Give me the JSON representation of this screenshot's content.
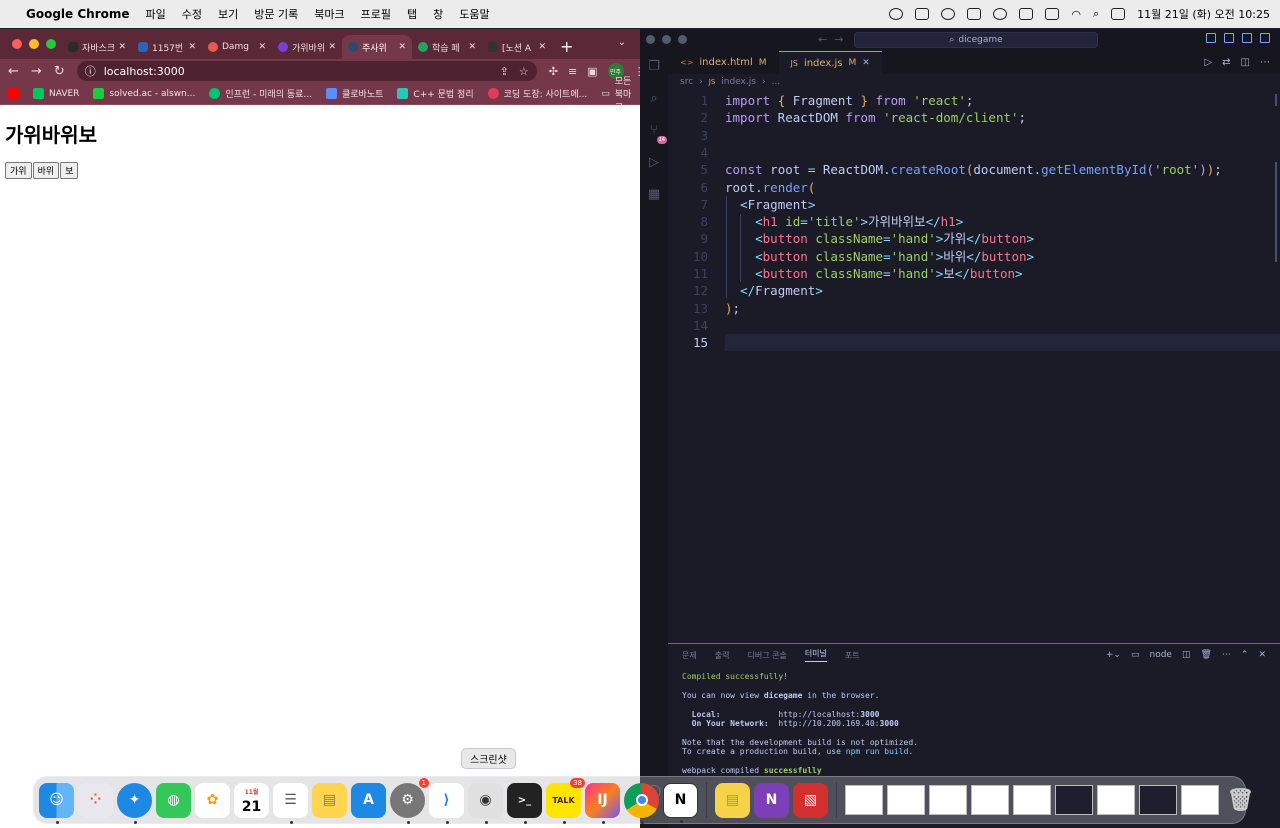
{
  "menubar": {
    "app": "Google Chrome",
    "items": [
      "파일",
      "수정",
      "보기",
      "방문 기록",
      "북마크",
      "프로필",
      "탭",
      "창",
      "도움말"
    ],
    "clock": "11월 21일 (화) 오전 10:25"
  },
  "chrome": {
    "tabs": [
      {
        "label": "자바스크",
        "color": "#2b2b2b"
      },
      {
        "label": "1157번",
        "color": "#2d62b8"
      },
      {
        "label": "Damg",
        "color": "#e85a4f"
      },
      {
        "label": "가위바위",
        "color": "#7b3fd6"
      },
      {
        "label": "주사위",
        "color": "#2a4a6b",
        "active": true
      },
      {
        "label": "학습 페",
        "color": "#1fa463"
      },
      {
        "label": "[노션 A",
        "color": "#333333"
      }
    ],
    "url": "localhost:3000",
    "profile": "민주",
    "bookmarks": [
      {
        "label": "",
        "color": "#ff0000"
      },
      {
        "label": "NAVER",
        "color": "#03c75a"
      },
      {
        "label": "solved.ac - alswn...",
        "color": "#17ce3a"
      },
      {
        "label": "인프런 - 미래의 동료...",
        "color": "#00c471"
      },
      {
        "label": "클로바노트",
        "color": "#5b8dfe"
      },
      {
        "label": "C++ 문법 정리",
        "color": "#2ec4b6"
      },
      {
        "label": "코딩 도장: 사이트에...",
        "color": "#e03c5a"
      }
    ],
    "all_bookmarks": "모든 북마크",
    "page": {
      "title": "가위바위보",
      "buttons": [
        "가위",
        "바위",
        "보"
      ]
    }
  },
  "vscode": {
    "search": "dicegame",
    "tabs": [
      {
        "icon": "<>",
        "label": "index.html",
        "mod": "M"
      },
      {
        "icon": "JS",
        "label": "index.js",
        "mod": "M",
        "active": true
      }
    ],
    "breadcrumb": [
      "src",
      "index.js",
      "..."
    ],
    "line_numbers": [
      "1",
      "2",
      "3",
      "4",
      "5",
      "6",
      "7",
      "8",
      "9",
      "10",
      "11",
      "12",
      "13",
      "14",
      "15"
    ],
    "panel_tabs": [
      "문제",
      "출력",
      "디버그 콘솔",
      "터미널",
      "포트"
    ],
    "panel_shell": "node",
    "terminal": {
      "compiled": "Compiled successfully!",
      "view_pre": "You can now view ",
      "view_app": "dicegame",
      "view_post": " in the browser.",
      "local_label": "Local:",
      "local_url": "http://localhost:",
      "local_port": "3000",
      "network_label": "On Your Network:",
      "network_url": "http://10.200.169.40:",
      "network_port": "3000",
      "note1": "Note that the development build is not optimized.",
      "note2_pre": "To create a production build, use ",
      "note2_cmd": "npm run build",
      "note2_post": ".",
      "webpack_pre": "webpack compiled ",
      "webpack_ok": "successfully"
    }
  },
  "dock": {
    "tooltip": "스크린샷",
    "calendar_month": "11월",
    "calendar_day": "21",
    "settings_badge": "1",
    "talk_badge": "38",
    "talk_label": "TALK"
  }
}
